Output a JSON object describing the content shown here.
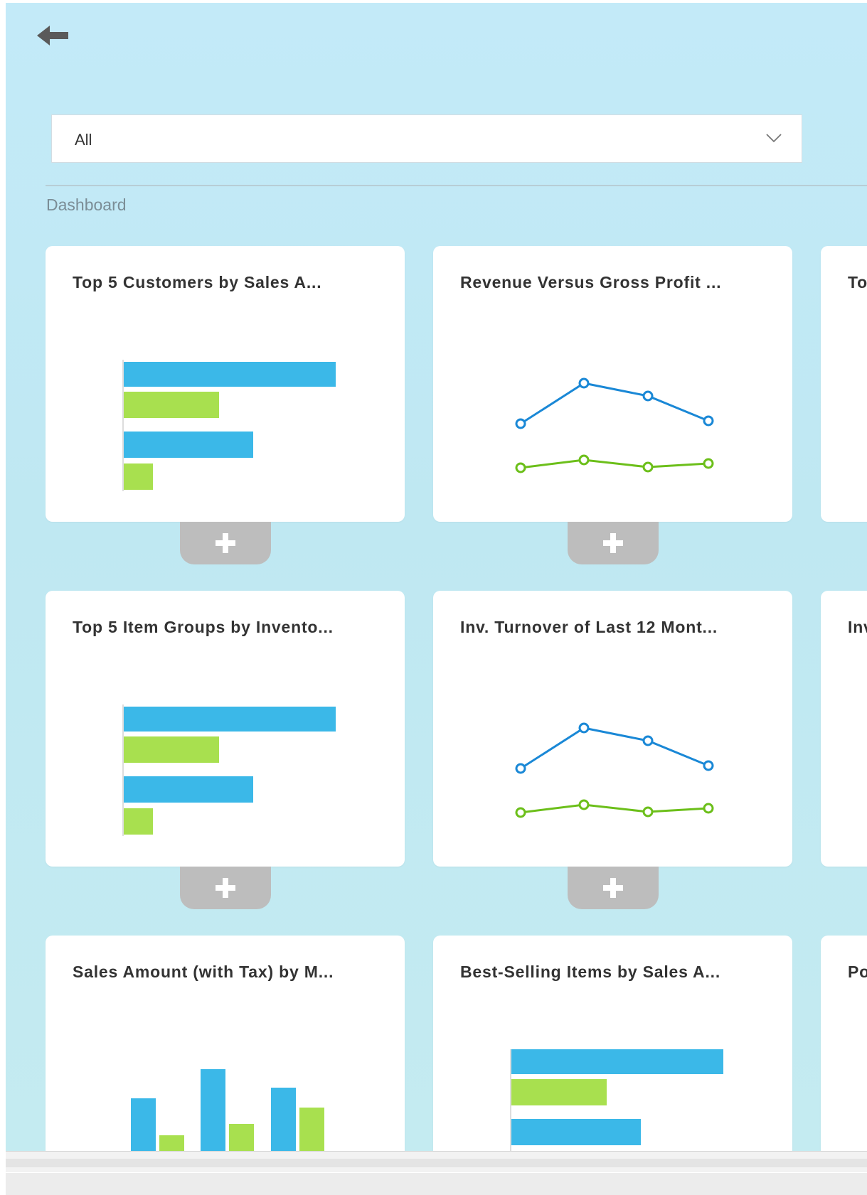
{
  "header": {
    "back_icon": "arrow-left-icon"
  },
  "filter": {
    "selected": "All",
    "icon": "chevron-down-icon"
  },
  "section": {
    "title": "Dashboard"
  },
  "colors": {
    "blue": "#3bb8e8",
    "green": "#a8e04f",
    "line_blue": "#1a88d6",
    "line_green": "#6cbf1a",
    "add_button": "#bdbdbd"
  },
  "cards": [
    {
      "title": "Top 5 Customers by Sales A...",
      "thumbnail": "horizontal-bar-icon"
    },
    {
      "title": "Revenue Versus Gross Profit ...",
      "thumbnail": "line-chart-icon"
    },
    {
      "title": "To",
      "thumbnail": ""
    },
    {
      "title": "Top 5 Item Groups by Invento...",
      "thumbnail": "horizontal-bar-icon"
    },
    {
      "title": "Inv. Turnover of Last 12 Mont...",
      "thumbnail": "line-chart-icon"
    },
    {
      "title": "Inv",
      "thumbnail": ""
    },
    {
      "title": "Sales Amount (with Tax) by M...",
      "thumbnail": "column-chart-icon"
    },
    {
      "title": "Best-Selling Items by Sales A...",
      "thumbnail": "horizontal-bar-icon"
    },
    {
      "title": "Po",
      "thumbnail": ""
    }
  ],
  "add_button": {
    "icon": "plus-icon"
  }
}
